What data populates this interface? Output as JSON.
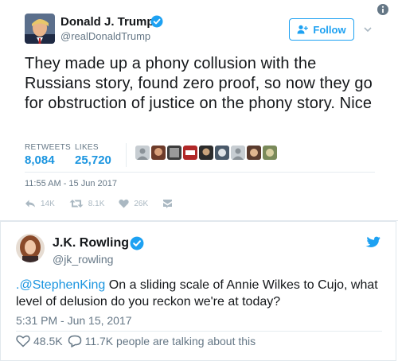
{
  "tweet1": {
    "name": "Donald J. Trump",
    "handle": "@realDonaldTrump",
    "follow_label": "Follow",
    "text": "They made up a phony collusion with the Russians story, found zero proof, so now they go for obstruction of justice on the phony story. Nice",
    "retweets_label": "RETWEETS",
    "retweets_value": "8,084",
    "likes_label": "LIKES",
    "likes_value": "25,720",
    "timestamp": "11:55 AM - 15 Jun 2017",
    "actions": {
      "reply": "14K",
      "retweet": "8.1K",
      "like": "26K"
    }
  },
  "tweet2": {
    "name": "J.K. Rowling",
    "handle": "@jk_rowling",
    "mention": ".@StephenKing",
    "text_rest": " On a sliding scale of Annie Wilkes to Cujo, what level of delusion do you reckon we're at today?",
    "timestamp": "5:31 PM - Jun 15, 2017",
    "likes": "48.5K",
    "replies_text": "11.7K people are talking about this"
  },
  "colors": {
    "accent": "#1da1f2",
    "link": "#1b95e0",
    "muted": "#657786",
    "action_gray": "#aab8c2"
  },
  "icons": [
    "info-icon",
    "verified-badge-icon",
    "follow-user-icon",
    "chevron-down-icon",
    "reply-icon",
    "retweet-icon",
    "heart-icon",
    "direct-message-icon",
    "twitter-bird-icon",
    "comment-icon"
  ]
}
